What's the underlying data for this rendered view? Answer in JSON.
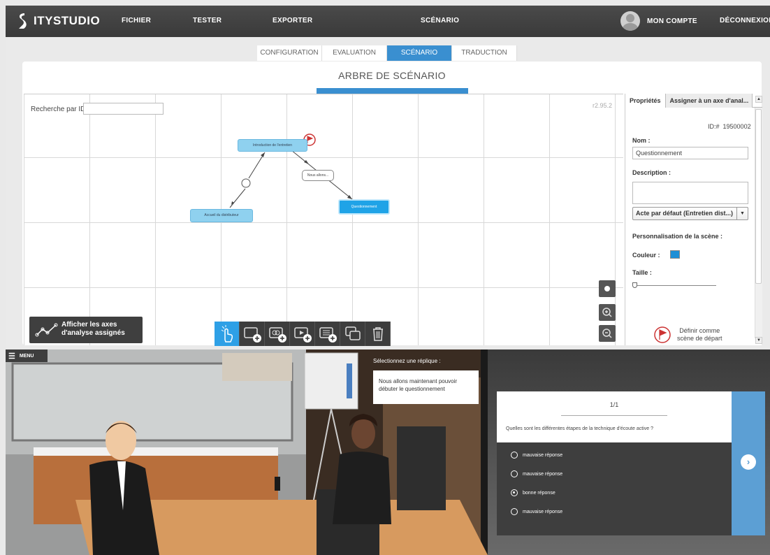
{
  "topbar": {
    "logo": "ITYSTUDIO",
    "menu": [
      "FICHIER",
      "TESTER",
      "EXPORTER"
    ],
    "center_title": "SCÉNARIO",
    "account": "MON COMPTE",
    "logout": "DÉCONNEXION"
  },
  "tabs": [
    {
      "label": "CONFIGURATION",
      "active": false
    },
    {
      "label": "EVALUATION",
      "active": false
    },
    {
      "label": "SCÉNARIO",
      "active": true
    },
    {
      "label": "TRADUCTION",
      "active": false
    }
  ],
  "editor": {
    "title": "ARBRE DE SCÉNARIO",
    "search_label": "Recherche par ID",
    "search_value": "",
    "version": "r2.95.2",
    "nodes": {
      "intro": "Introduction de l'entretien",
      "accueil": "Accueil du distributeur",
      "questionnement": "Questionnement",
      "bubble": "Nous allons..."
    },
    "axes_button_line1": "Afficher les axes",
    "axes_button_line2": "d'analyse assignés"
  },
  "properties": {
    "tab_props": "Propriétés",
    "tab_axes": "Assigner à un axe d'anal...",
    "id_label": "ID:#",
    "id_value": "19500002",
    "name_label": "Nom :",
    "name_value": "Questionnement",
    "description_label": "Description :",
    "description_value": "",
    "act_select": "Acte par défaut (Entretien dist...)",
    "customization_label": "Personnalisation de la scène :",
    "color_label": "Couleur :",
    "color_value": "#1f8fd6",
    "size_label": "Taille :",
    "size_value": 0.0,
    "start_line1": "Définir comme",
    "start_line2": "scène de départ"
  },
  "scene": {
    "menu": "MENU",
    "reply_label": "Sélectionnez une réplique :",
    "reply_text": "Nous allons maintenant pouvoir débuter le questionnement"
  },
  "quiz": {
    "count": "1/1",
    "question": "Quelles sont les différentes étapes de la technique d'écoute active ?",
    "answers": [
      {
        "label": "mauvaise réponse",
        "selected": false
      },
      {
        "label": "mauvaise réponse",
        "selected": false
      },
      {
        "label": "bonne réponse",
        "selected": true
      },
      {
        "label": "mauvaise réponse",
        "selected": false
      }
    ]
  },
  "colors": {
    "accent": "#3a8fd0",
    "topbar": "#404040"
  }
}
